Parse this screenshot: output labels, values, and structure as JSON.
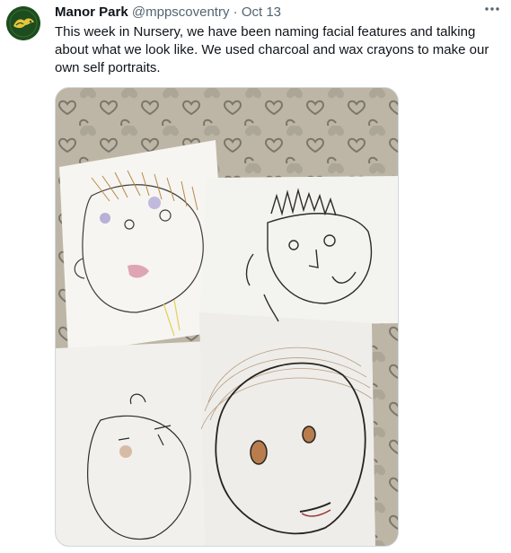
{
  "tweet": {
    "author_name": "Manor Park",
    "author_handle": "@mppscoventry",
    "separator": "·",
    "date": "Oct 13",
    "text": "This week in Nursery, we have been naming facial features and talking about what we look like. We used charcoal and wax crayons to make our own self portraits.",
    "more_icon": "more-horizontal-icon",
    "avatar_icon": "school-logo-icon"
  },
  "colors": {
    "avatar_bg": "#1d4d1f",
    "avatar_mark": "#e8c33a",
    "text": "#0f1419",
    "muted": "#536471"
  }
}
